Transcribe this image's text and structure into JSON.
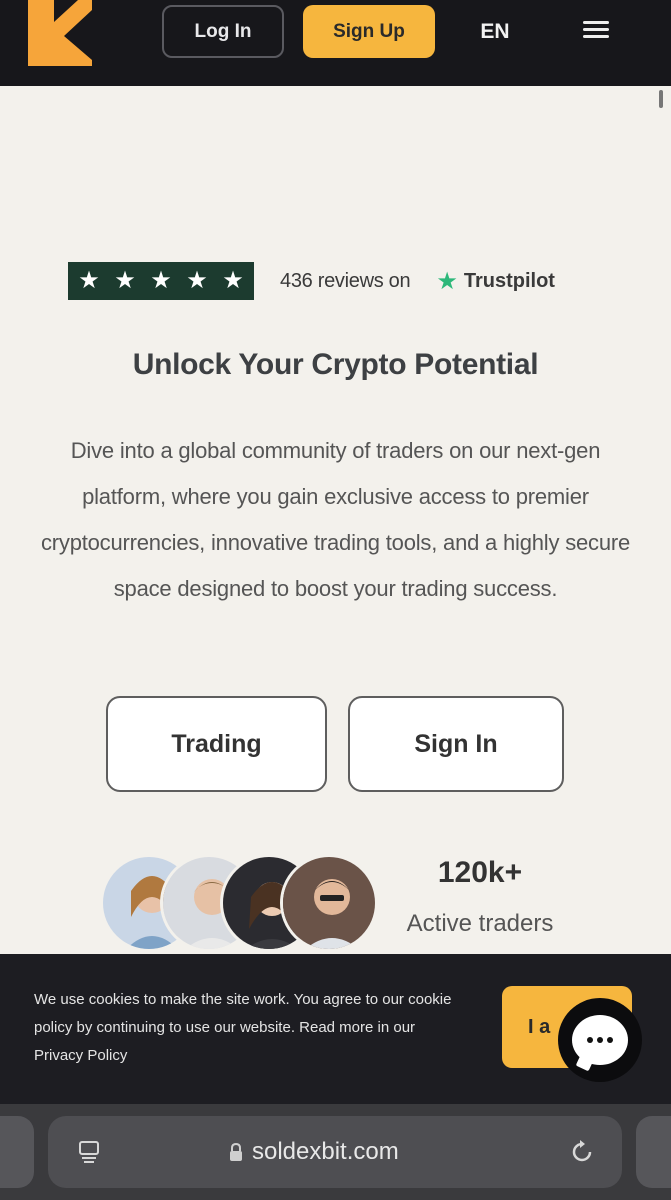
{
  "nav": {
    "login_label": "Log In",
    "signup_label": "Sign Up",
    "language": "EN"
  },
  "colors": {
    "accent": "#f6b63e",
    "nav_bg": "#17171b",
    "page_bg": "#f3f1ec",
    "trustpilot_green": "#2db87a",
    "stars_bg": "#1c3b2f"
  },
  "rating": {
    "stars": 5,
    "reviews_text": "436 reviews on",
    "platform": "Trustpilot"
  },
  "hero": {
    "title": "Unlock Your Crypto Potential",
    "description": "Dive into a global community of traders on our next-gen platform, where you gain exclusive access to premier cryptocurrencies, innovative trading tools, and a highly secure space designed to boost your trading success."
  },
  "buttons": {
    "trading": "Trading",
    "signin": "Sign In"
  },
  "stats": {
    "count": "120k+",
    "label": "Active traders"
  },
  "cookie": {
    "text": "We use cookies to make the site work. You agree to our cookie policy by continuing to use our website. Read more in our Privacy Policy",
    "accept_visible": "I a"
  },
  "browser": {
    "url": "soldexbit.com"
  },
  "icons": [
    "logo-icon",
    "menu-icon",
    "star-icon",
    "trustpilot-star-icon",
    "chat-icon",
    "tabs-icon",
    "lock-icon",
    "reload-icon"
  ]
}
